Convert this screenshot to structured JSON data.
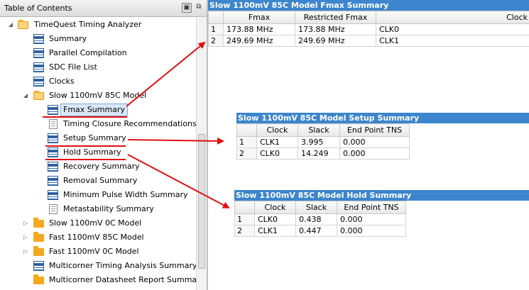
{
  "toc": {
    "title": "Table of Contents",
    "pin_icon": "pin-icon",
    "restore_icon": "restore-window-icon",
    "items": [
      {
        "label": "TimeQuest Timing Analyzer",
        "icon": "folder-open-icon",
        "expanded": true,
        "level": 0
      },
      {
        "label": "Summary",
        "icon": "table-icon",
        "level": 1
      },
      {
        "label": "Parallel Compilation",
        "icon": "table-icon",
        "level": 1
      },
      {
        "label": "SDC File List",
        "icon": "table-icon",
        "level": 1
      },
      {
        "label": "Clocks",
        "icon": "table-icon",
        "level": 1
      },
      {
        "label": "Slow 1100mV 85C Model",
        "icon": "folder-open-icon",
        "expanded": true,
        "level": 1
      },
      {
        "label": "Fmax Summary",
        "icon": "table-icon",
        "level": 2,
        "selected": true
      },
      {
        "label": "Timing Closure Recommendations",
        "icon": "document-icon",
        "level": 2
      },
      {
        "label": "Setup Summary",
        "icon": "table-icon",
        "level": 2
      },
      {
        "label": "Hold Summary",
        "icon": "table-icon",
        "level": 2
      },
      {
        "label": "Recovery Summary",
        "icon": "table-icon",
        "level": 2
      },
      {
        "label": "Removal Summary",
        "icon": "table-icon",
        "level": 2
      },
      {
        "label": "Minimum Pulse Width Summary",
        "icon": "table-icon",
        "level": 2
      },
      {
        "label": "Metastability Summary",
        "icon": "document-icon",
        "level": 2
      },
      {
        "label": "Slow 1100mV 0C Model",
        "icon": "folder-icon",
        "expanded": false,
        "level": 1
      },
      {
        "label": "Fast 1100mV 85C Model",
        "icon": "folder-icon",
        "expanded": false,
        "level": 1
      },
      {
        "label": "Fast 1100mV 0C Model",
        "icon": "folder-icon",
        "expanded": false,
        "level": 1
      },
      {
        "label": "Multicorner Timing Analysis Summary",
        "icon": "table-icon",
        "level": 1
      },
      {
        "label": "Multicorner Datasheet Report Summary",
        "icon": "folder-icon",
        "level": 1
      }
    ]
  },
  "fmax": {
    "title": "Slow 1100mV 85C Model Fmax Summary",
    "columns": [
      "",
      "Fmax",
      "Restricted Fmax",
      "Clock"
    ],
    "rows": [
      [
        "1",
        "173.88 MHz",
        "173.88 MHz",
        "CLK0"
      ],
      [
        "2",
        "249.69 MHz",
        "249.69 MHz",
        "CLK1"
      ]
    ]
  },
  "setup": {
    "title": "Slow 1100mV 85C Model Setup Summary",
    "columns": [
      "",
      "Clock",
      "Slack",
      "End Point TNS"
    ],
    "rows": [
      [
        "1",
        "CLK1",
        "3.995",
        "0.000"
      ],
      [
        "2",
        "CLK0",
        "14.249",
        "0.000"
      ]
    ]
  },
  "hold": {
    "title": "Slow 1100mV 85C Model Hold Summary",
    "columns": [
      "",
      "Clock",
      "Slack",
      "End Point TNS"
    ],
    "rows": [
      [
        "1",
        "CLK0",
        "0.438",
        "0.000"
      ],
      [
        "2",
        "CLK1",
        "0.447",
        "0.000"
      ]
    ]
  },
  "annotation_color": "#e01010",
  "accent_color": "#3d85cc"
}
